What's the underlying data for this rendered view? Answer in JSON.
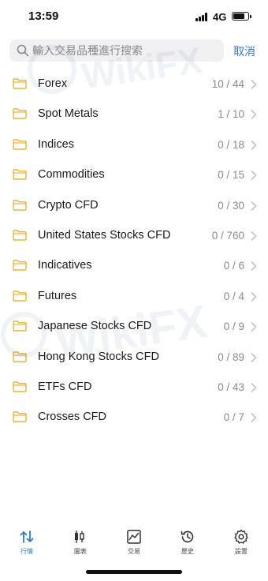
{
  "status": {
    "time": "13:59",
    "network": "4G",
    "battery_level": 0.85
  },
  "search": {
    "placeholder": "輸入交易品種進行搜索",
    "value": "",
    "cancel_label": "取消"
  },
  "folders": [
    {
      "name": "Forex",
      "count": "10 / 44"
    },
    {
      "name": "Spot Metals",
      "count": "1 / 10"
    },
    {
      "name": "Indices",
      "count": "0 / 18"
    },
    {
      "name": "Commodities",
      "count": "0 / 15"
    },
    {
      "name": "Crypto CFD",
      "count": "0 / 30"
    },
    {
      "name": "United States Stocks CFD",
      "count": "0 / 760"
    },
    {
      "name": "Indicatives",
      "count": "0 / 6"
    },
    {
      "name": "Futures",
      "count": "0 / 4"
    },
    {
      "name": "Japanese Stocks CFD",
      "count": "0 / 9"
    },
    {
      "name": "Hong Kong Stocks CFD",
      "count": "0 / 89"
    },
    {
      "name": "ETFs CFD",
      "count": "0 / 43"
    },
    {
      "name": "Crosses CFD",
      "count": "0 / 7"
    }
  ],
  "tabs": [
    {
      "label": "行情",
      "icon": "quotes-icon",
      "active": true
    },
    {
      "label": "圖表",
      "icon": "chart-icon",
      "active": false
    },
    {
      "label": "交易",
      "icon": "trade-icon",
      "active": false
    },
    {
      "label": "歷史",
      "icon": "history-icon",
      "active": false
    },
    {
      "label": "設置",
      "icon": "settings-icon",
      "active": false
    }
  ],
  "watermark": {
    "text": "WikiFX"
  },
  "colors": {
    "accent": "#2a7ad8",
    "folder": "#e8b534",
    "count": "#8a8a8a",
    "chevron": "#c4c4c8"
  }
}
